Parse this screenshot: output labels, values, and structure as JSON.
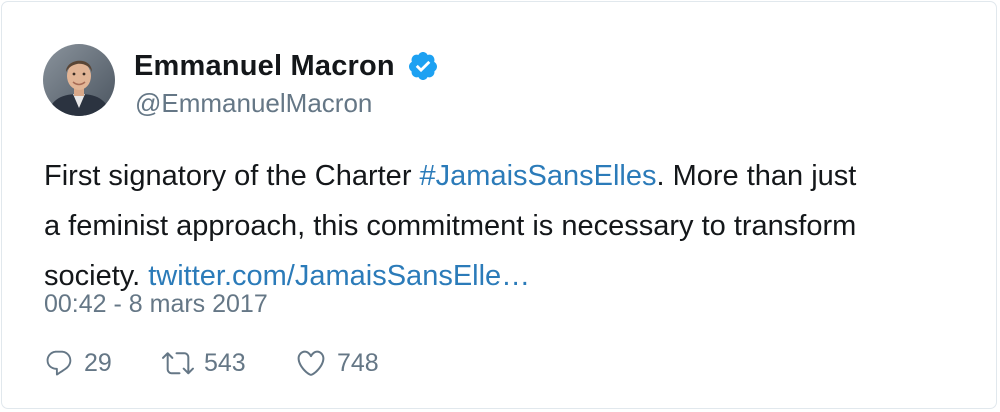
{
  "author": {
    "name": "Emmanuel Macron",
    "handle": "@EmmanuelMacron"
  },
  "tweet": {
    "line1_before": "First signatory of the Charter ",
    "hashtag": "#JamaisSansElles",
    "line1_after": ". More than just",
    "line2": "a feminist approach, this commitment is necessary to transform",
    "line3_before": "society. ",
    "link": "twitter.com/JamaisSansElle…"
  },
  "timestamp": "00:42 - 8 mars 2017",
  "actions": {
    "replies": "29",
    "retweets": "543",
    "likes": "748"
  },
  "colors": {
    "link": "#2b7bb9",
    "verified": "#1da1f2",
    "muted": "#657786",
    "text": "#14171a"
  },
  "icons": {
    "verified": "verified-badge-icon",
    "reply": "reply-icon",
    "retweet": "retweet-icon",
    "like": "heart-icon"
  }
}
